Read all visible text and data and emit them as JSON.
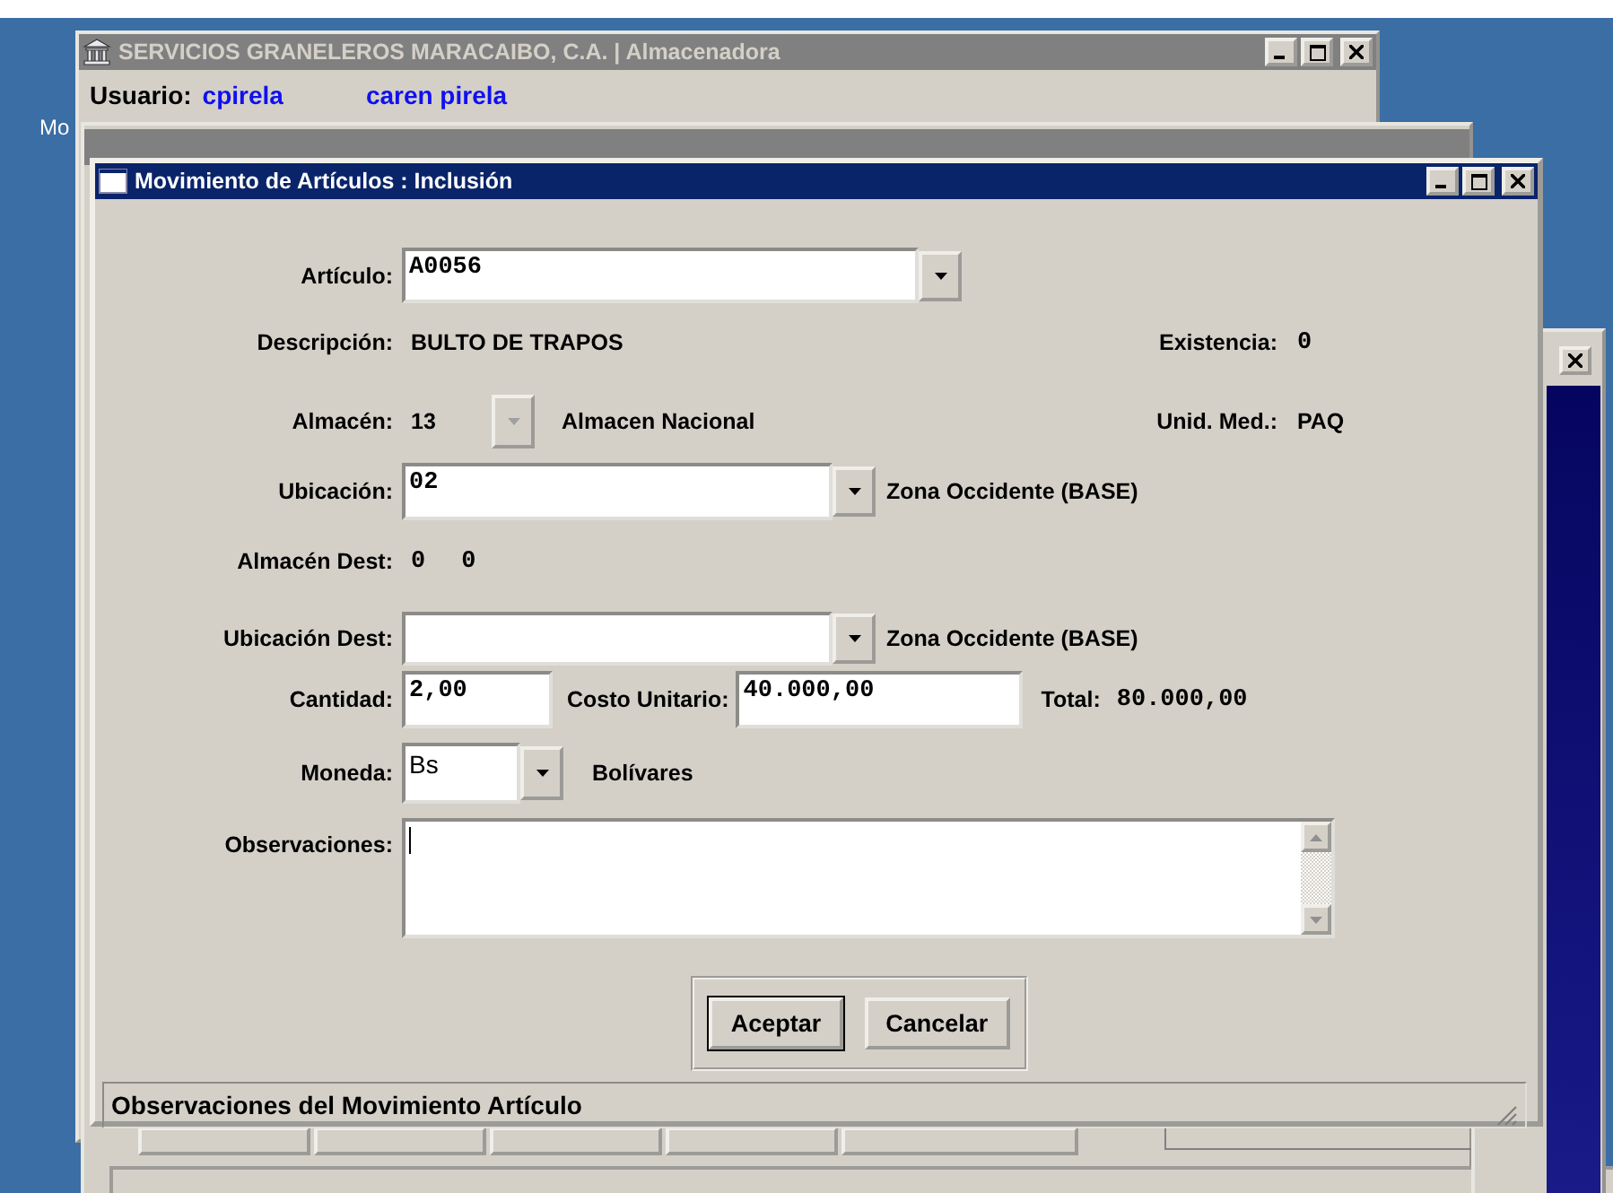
{
  "desktop": {
    "label": "Mo"
  },
  "main_window": {
    "title": "SERVICIOS GRANELEROS MARACAIBO, C.A. | Almacenadora",
    "active": false,
    "user_label": "Usuario:",
    "user_login": "cpirela",
    "user_name": "caren pirela"
  },
  "dialog": {
    "title": "Movimiento de Artículos : Inclusión",
    "active": true,
    "articulo": {
      "label": "Artículo:",
      "value": "A0056"
    },
    "descripcion": {
      "label": "Descripción:",
      "value": "BULTO DE TRAPOS"
    },
    "existencia": {
      "label": "Existencia:",
      "value": "0"
    },
    "almacen": {
      "label": "Almacén:",
      "code": "13",
      "disabled": true,
      "name": "Almacen Nacional"
    },
    "unid_med": {
      "label": "Unid. Med.:",
      "value": "PAQ"
    },
    "ubicacion": {
      "label": "Ubicación:",
      "value": "02",
      "name": "Zona Occidente (BASE)"
    },
    "almacen_dest": {
      "label": "Almacén Dest:",
      "code": "0",
      "name": "0"
    },
    "ubicacion_dest": {
      "label": "Ubicación Dest:",
      "name": "Zona Occidente (BASE)"
    },
    "cantidad": {
      "label": "Cantidad:",
      "value": "2,00"
    },
    "costo_unitario": {
      "label": "Costo Unitario:",
      "value": "40.000,00"
    },
    "total": {
      "label": "Total:",
      "value": "80.000,00"
    },
    "moneda": {
      "label": "Moneda:",
      "value": "Bs",
      "name": "Bolívares"
    },
    "observaciones": {
      "label": "Observaciones:"
    },
    "buttons": [
      {
        "label": "Aceptar",
        "default": true
      },
      {
        "label": "Cancelar",
        "default": false
      }
    ],
    "status_bar": "Observaciones del Movimiento Artículo"
  }
}
